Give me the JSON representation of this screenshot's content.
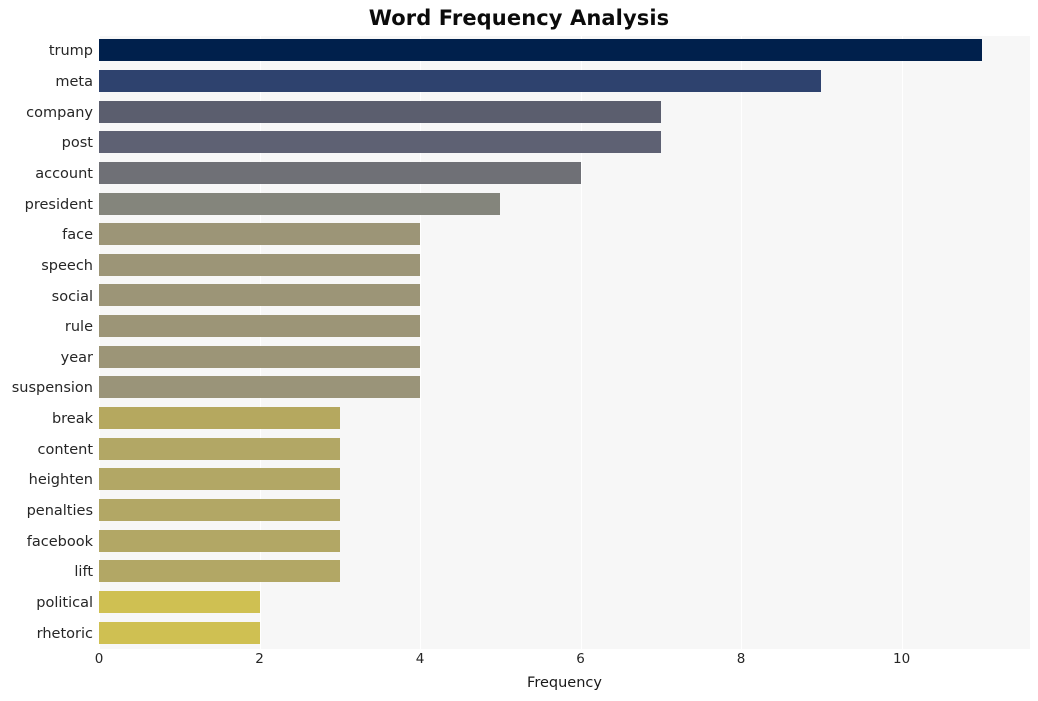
{
  "chart_data": {
    "type": "bar",
    "orientation": "horizontal",
    "title": "Word Frequency Analysis",
    "xlabel": "Frequency",
    "ylabel": "",
    "categories": [
      "trump",
      "meta",
      "company",
      "post",
      "account",
      "president",
      "face",
      "speech",
      "social",
      "rule",
      "year",
      "suspension",
      "break",
      "content",
      "heighten",
      "penalties",
      "facebook",
      "lift",
      "political",
      "rhetoric"
    ],
    "values": [
      11,
      9,
      7,
      7,
      6,
      5,
      4,
      4,
      4,
      4,
      4,
      4,
      3,
      3,
      3,
      3,
      3,
      3,
      2,
      2
    ],
    "bar_colors": [
      "#00204c",
      "#2e426e",
      "#5b5e6e",
      "#5e6173",
      "#6f7076",
      "#84857c",
      "#9c9577",
      "#9c9577",
      "#9c9577",
      "#9c9577",
      "#9c9577",
      "#9a9479",
      "#b5a85f",
      "#b2a765",
      "#b2a765",
      "#b2a765",
      "#b2a765",
      "#b2a765",
      "#cfc052",
      "#cfc052"
    ],
    "xlim": [
      0,
      11.6
    ],
    "xticks": [
      0,
      2,
      4,
      6,
      8,
      10
    ],
    "xticklabels": [
      "0",
      "2",
      "4",
      "6",
      "8",
      "10"
    ],
    "grid": true,
    "grid_axis": "x",
    "grid_color": "#ffffff",
    "plot_background": "#f7f7f7",
    "figure_background": "#ffffff",
    "legend": null,
    "colormap": "cividis"
  }
}
